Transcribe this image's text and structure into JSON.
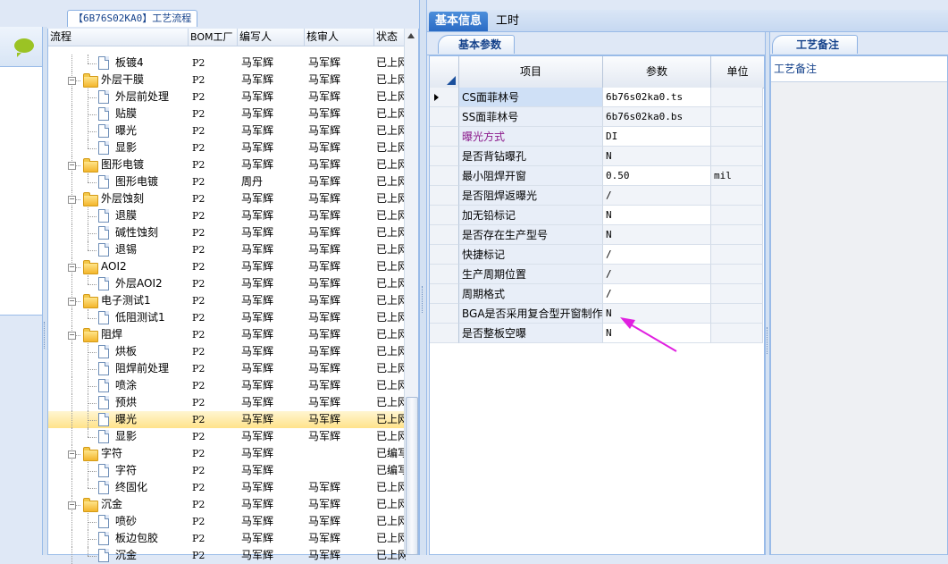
{
  "tree_tab": {
    "code": "【6B76S02KA0】",
    "title": "工艺流程"
  },
  "tree_columns": [
    "流程",
    "BOM工厂",
    "编写人",
    "核审人",
    "状态"
  ],
  "tree_rows": [
    {
      "name": "板镀4",
      "level": 2,
      "type": "doc",
      "factory": "P2",
      "writer": "马军辉",
      "reviewer": "马军辉",
      "status": "已上网"
    },
    {
      "name": "外层干膜",
      "level": 1,
      "type": "folder",
      "factory": "P2",
      "writer": "马军辉",
      "reviewer": "马军辉",
      "status": "已上网"
    },
    {
      "name": "外层前处理",
      "level": 2,
      "type": "doc",
      "factory": "P2",
      "writer": "马军辉",
      "reviewer": "马军辉",
      "status": "已上网"
    },
    {
      "name": "贴膜",
      "level": 2,
      "type": "doc",
      "factory": "P2",
      "writer": "马军辉",
      "reviewer": "马军辉",
      "status": "已上网"
    },
    {
      "name": "曝光",
      "level": 2,
      "type": "doc",
      "factory": "P2",
      "writer": "马军辉",
      "reviewer": "马军辉",
      "status": "已上网"
    },
    {
      "name": "显影",
      "level": 2,
      "type": "doc",
      "factory": "P2",
      "writer": "马军辉",
      "reviewer": "马军辉",
      "status": "已上网"
    },
    {
      "name": "图形电镀",
      "level": 1,
      "type": "folder",
      "factory": "P2",
      "writer": "马军辉",
      "reviewer": "马军辉",
      "status": "已上网"
    },
    {
      "name": "图形电镀",
      "level": 2,
      "type": "doc",
      "factory": "P2",
      "writer": "周丹",
      "reviewer": "马军辉",
      "status": "已上网"
    },
    {
      "name": "外层蚀刻",
      "level": 1,
      "type": "folder",
      "factory": "P2",
      "writer": "马军辉",
      "reviewer": "马军辉",
      "status": "已上网"
    },
    {
      "name": "退膜",
      "level": 2,
      "type": "doc",
      "factory": "P2",
      "writer": "马军辉",
      "reviewer": "马军辉",
      "status": "已上网"
    },
    {
      "name": "碱性蚀刻",
      "level": 2,
      "type": "doc",
      "factory": "P2",
      "writer": "马军辉",
      "reviewer": "马军辉",
      "status": "已上网"
    },
    {
      "name": "退锡",
      "level": 2,
      "type": "doc",
      "factory": "P2",
      "writer": "马军辉",
      "reviewer": "马军辉",
      "status": "已上网"
    },
    {
      "name": "AOI2",
      "level": 1,
      "type": "folder",
      "factory": "P2",
      "writer": "马军辉",
      "reviewer": "马军辉",
      "status": "已上网"
    },
    {
      "name": "外层AOI2",
      "level": 2,
      "type": "doc",
      "factory": "P2",
      "writer": "马军辉",
      "reviewer": "马军辉",
      "status": "已上网"
    },
    {
      "name": "电子测试1",
      "level": 1,
      "type": "folder",
      "factory": "P2",
      "writer": "马军辉",
      "reviewer": "马军辉",
      "status": "已上网"
    },
    {
      "name": "低阻测试1",
      "level": 2,
      "type": "doc",
      "factory": "P2",
      "writer": "马军辉",
      "reviewer": "马军辉",
      "status": "已上网"
    },
    {
      "name": "阻焊",
      "level": 1,
      "type": "folder",
      "factory": "P2",
      "writer": "马军辉",
      "reviewer": "马军辉",
      "status": "已上网"
    },
    {
      "name": "烘板",
      "level": 2,
      "type": "doc",
      "factory": "P2",
      "writer": "马军辉",
      "reviewer": "马军辉",
      "status": "已上网"
    },
    {
      "name": "阻焊前处理",
      "level": 2,
      "type": "doc",
      "factory": "P2",
      "writer": "马军辉",
      "reviewer": "马军辉",
      "status": "已上网"
    },
    {
      "name": "喷涂",
      "level": 2,
      "type": "doc",
      "factory": "P2",
      "writer": "马军辉",
      "reviewer": "马军辉",
      "status": "已上网"
    },
    {
      "name": "预烘",
      "level": 2,
      "type": "doc",
      "factory": "P2",
      "writer": "马军辉",
      "reviewer": "马军辉",
      "status": "已上网"
    },
    {
      "name": "曝光",
      "level": 2,
      "type": "doc",
      "factory": "P2",
      "writer": "马军辉",
      "reviewer": "马军辉",
      "status": "已上网",
      "selected": true
    },
    {
      "name": "显影",
      "level": 2,
      "type": "doc",
      "factory": "P2",
      "writer": "马军辉",
      "reviewer": "马军辉",
      "status": "已上网"
    },
    {
      "name": "字符",
      "level": 1,
      "type": "folder",
      "factory": "P2",
      "writer": "马军辉",
      "reviewer": "",
      "status": "已编写"
    },
    {
      "name": "字符",
      "level": 2,
      "type": "doc",
      "factory": "P2",
      "writer": "马军辉",
      "reviewer": "",
      "status": "已编写"
    },
    {
      "name": "终固化",
      "level": 2,
      "type": "doc",
      "factory": "P2",
      "writer": "马军辉",
      "reviewer": "马军辉",
      "status": "已上网"
    },
    {
      "name": "沉金",
      "level": 1,
      "type": "folder",
      "factory": "P2",
      "writer": "马军辉",
      "reviewer": "马军辉",
      "status": "已上网"
    },
    {
      "name": "喷砂",
      "level": 2,
      "type": "doc",
      "factory": "P2",
      "writer": "马军辉",
      "reviewer": "马军辉",
      "status": "已上网"
    },
    {
      "name": "板边包胶",
      "level": 2,
      "type": "doc",
      "factory": "P2",
      "writer": "马军辉",
      "reviewer": "马军辉",
      "status": "已上网"
    },
    {
      "name": "沉金",
      "level": 2,
      "type": "doc",
      "factory": "P2",
      "writer": "马军辉",
      "reviewer": "马军辉",
      "status": "已上网"
    }
  ],
  "main_tabs": [
    "基本信息",
    "工时"
  ],
  "sub_tab": "基本参数",
  "grid_columns": {
    "item": "项目",
    "param": "参数",
    "unit": "单位"
  },
  "grid_rows": [
    {
      "item": "CS面菲林号",
      "param": "6b76s02ka0.ts",
      "unit": "",
      "current": true
    },
    {
      "item": "SS面菲林号",
      "param": "6b76s02ka0.bs",
      "unit": ""
    },
    {
      "item": "曝光方式",
      "param": "DI",
      "unit": "",
      "color": "#8b1a8b"
    },
    {
      "item": "是否背钻曝孔",
      "param": "N",
      "unit": ""
    },
    {
      "item": "最小阻焊开窗",
      "param": "0.50",
      "unit": "mil"
    },
    {
      "item": "是否阻焊返曝光",
      "param": "/",
      "unit": ""
    },
    {
      "item": "加无铅标记",
      "param": "N",
      "unit": ""
    },
    {
      "item": "是否存在生产型号",
      "param": "N",
      "unit": ""
    },
    {
      "item": "快捷标记",
      "param": "/",
      "unit": ""
    },
    {
      "item": "生产周期位置",
      "param": "/",
      "unit": ""
    },
    {
      "item": "周期格式",
      "param": "/",
      "unit": ""
    },
    {
      "item": "BGA是否采用复合型开窗制作",
      "param": "N",
      "unit": ""
    },
    {
      "item": "是否整板空曝",
      "param": "N",
      "unit": ""
    }
  ],
  "remark_tab": "工艺备注",
  "remark_header": "工艺备注",
  "colors": {
    "accent": "#2b6bc4",
    "border": "#99bbe8",
    "annotation_arrow": "#e020e0"
  }
}
